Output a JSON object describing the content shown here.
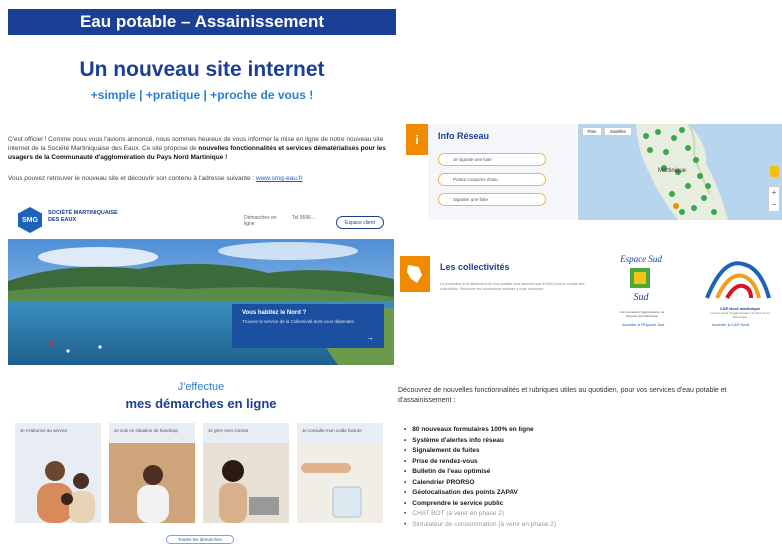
{
  "header": {
    "banner": "Eau potable – Assainissement",
    "headline": "Un nouveau site internet",
    "subline": "+simple | +pratique | +proche de vous !"
  },
  "intro": {
    "p1_start": "C'est officiel ! Comme nous vous l'avions annoncé, nous sommes heureux de vous informer la mise en ligne de notre nouveau site internet de la Société Martiniquaise des Eaux. Ce site propose de ",
    "p1_bold": "nouvelles fonctionnalités et services dématérialisés pour les usagers de la Communauté d'agglomération du Pays Nord Martinique !",
    "p2_start": "Vous pouvez retrouver le nouveau site et découvrir son contenu à l'adresse suivante : ",
    "p2_link": "www.smg-eau.fr"
  },
  "smg": {
    "logo": "SMG",
    "name": "SOCIÉTÉ MARTINIQUAISE DES EAUX",
    "nav1": "Démarches en ligne",
    "nav2": "Tel 0596 ...",
    "button": "Espace client",
    "card_title": "Vous habitez le Nord ?",
    "card_sub": "Trouvez le service de la Collectivité dont vous dépendez"
  },
  "info_reseau": {
    "icon": "i",
    "title": "Info Réseau",
    "buttons": [
      "Je signale une fuite",
      "Portes coupures d'eau",
      "Signaler une fuite"
    ],
    "map_buttons": [
      "Plan",
      "Satellite"
    ],
    "map_label": "Martinique"
  },
  "collectivites": {
    "title": "Les collectivités",
    "text": "La production et la distribution de l'eau potable sont assurées par la SMG pour le compte des collectivités. Retrouvez les informations relatives à votre commune.",
    "logo1_text": "Espace Sud",
    "logo1_caption": "Communauté d'Agglomération de l'Espace Sud Martinique",
    "logo2_text": "CAP Nord martinique",
    "logo2_caption": "Communauté d'agglomération du Pays Nord Martinique",
    "link1": "Accéder à l'Espace Sud",
    "link2": "Accéder à CAP Nord"
  },
  "demarches": {
    "line1": "J'effectue",
    "line2": "mes démarches en ligne",
    "cards": [
      "Je m'abonne au service",
      "Je suis en situation de handicap",
      "Je gère mon contrat",
      "Je consulte mon solde facture"
    ],
    "button": "Toutes les démarches"
  },
  "features": {
    "intro": "Découvrez de nouvelles fonctionnalités et rubriques utiles au quotidien, pour vos services d'eau potable et d'assainissement :",
    "items": [
      {
        "text": "80 nouveaux formulaires 100% en ligne",
        "muted": false
      },
      {
        "text": "Système d'alertes info réseau",
        "muted": false
      },
      {
        "text": "Signalement de fuites",
        "muted": false
      },
      {
        "text": "Prise de rendez-vous",
        "muted": false
      },
      {
        "text": "Bulletin de l'eau optimisé",
        "muted": false
      },
      {
        "text": "Calendrier PRORSO",
        "muted": false
      },
      {
        "text": "Géolocalisation des points ZAPAV",
        "muted": false
      },
      {
        "text": "Comprendre le service public",
        "muted": false
      },
      {
        "text": "CHAT BOT (à venir en phase 2)",
        "muted": true
      },
      {
        "text": "Simulateur de consommation (à venir en phase 2)",
        "muted": true
      }
    ]
  },
  "colors": {
    "brand_blue": "#1b3f94",
    "accent_orange": "#f08a00",
    "link_blue": "#1b5fc4"
  }
}
